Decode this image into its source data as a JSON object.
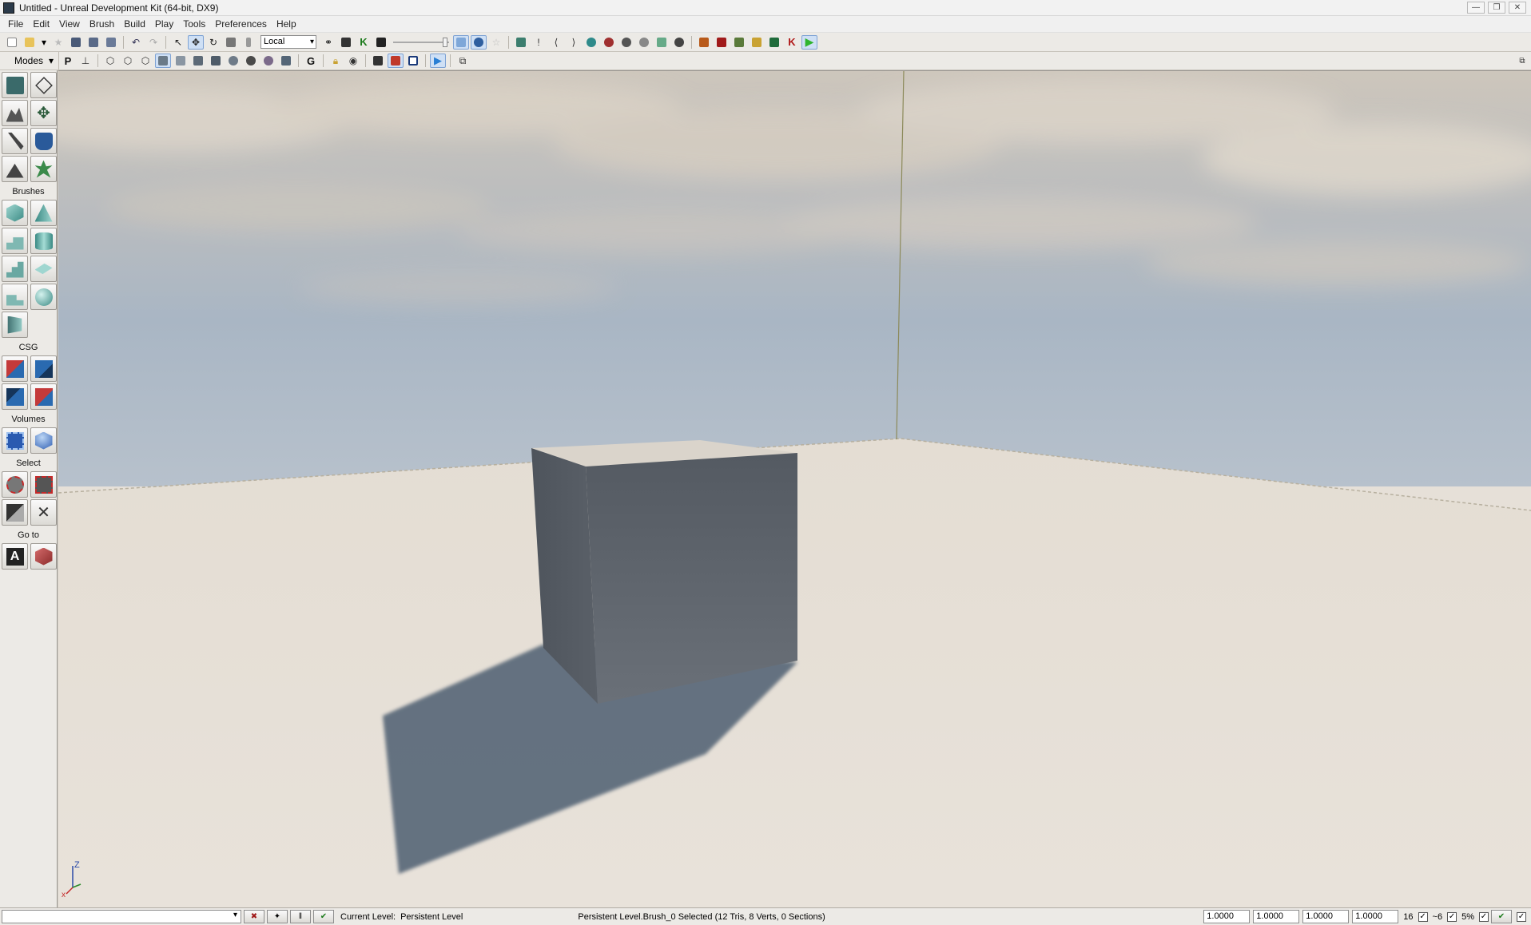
{
  "window": {
    "title": "Untitled - Unreal Development Kit (64-bit, DX9)",
    "controls": [
      "—",
      "❐",
      "✕"
    ]
  },
  "menu": [
    "File",
    "Edit",
    "View",
    "Brush",
    "Build",
    "Play",
    "Tools",
    "Preferences",
    "Help"
  ],
  "toolbar": {
    "coordinate_system": "Local",
    "letters": {
      "kismet": "K",
      "p": "P",
      "g": "G"
    }
  },
  "left_panel": {
    "modes_label": "Modes",
    "brushes_label": "Brushes",
    "csg_label": "CSG",
    "volumes_label": "Volumes",
    "select_label": "Select",
    "goto_label": "Go to"
  },
  "viewport": {
    "axis_z": "Z",
    "axis_x": "x"
  },
  "statusbar": {
    "current_level_label": "Current Level:",
    "current_level_value": "Persistent Level",
    "selection_info": "Persistent Level.Brush_0 Selected (12 Tris, 8 Verts, 0 Sections)",
    "drag_grid_values": [
      "1.0000",
      "1.0000",
      "1.0000",
      "1.0000"
    ],
    "grid_size": "16",
    "rotation_snap": "~6",
    "scale_snap": "5%"
  },
  "colors": {
    "sky_top": "#cbc4b9",
    "sky_horizon": "#aab7c6",
    "floor": "#e6dfd6",
    "cube_front": "#5d636c",
    "shadow": "#566677",
    "play_green": "#2fb52f"
  }
}
